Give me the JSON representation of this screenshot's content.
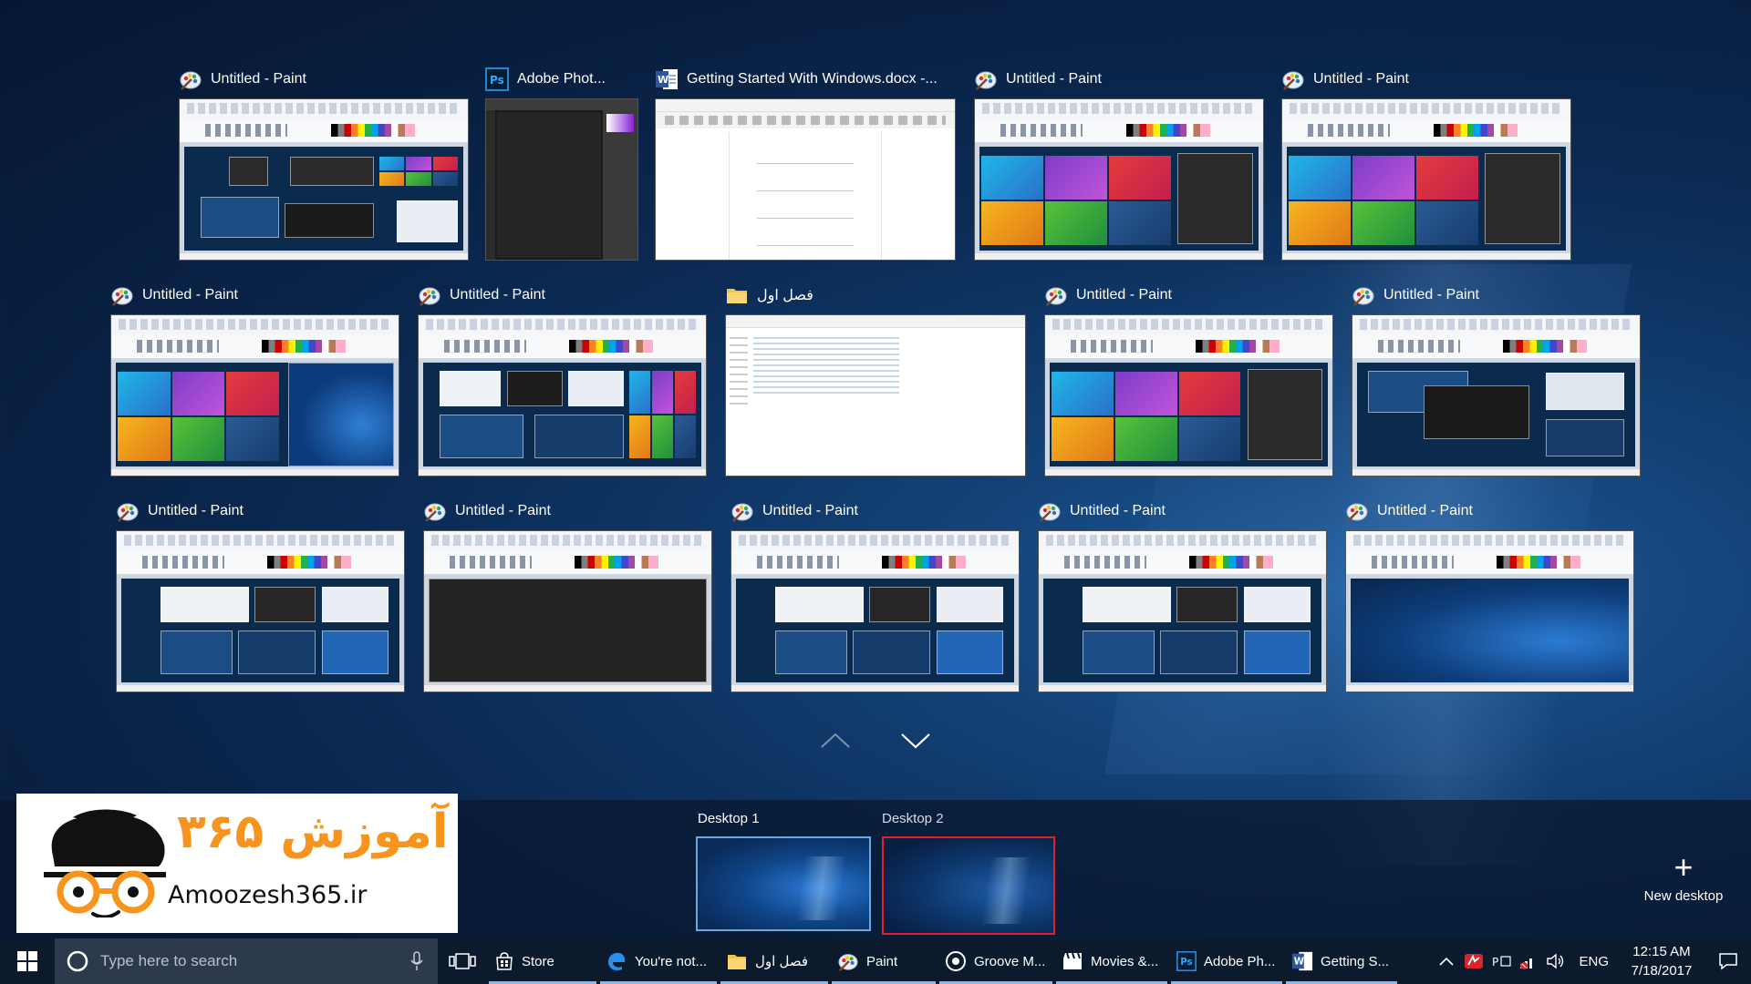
{
  "task_view": {
    "windows": [
      {
        "id": "w1",
        "app": "paint",
        "title": "Untitled - Paint"
      },
      {
        "id": "w2",
        "app": "photoshop",
        "title": "Adobe Phot..."
      },
      {
        "id": "w3",
        "app": "word",
        "title": "Getting Started With Windows.docx -..."
      },
      {
        "id": "w4",
        "app": "paint",
        "title": "Untitled - Paint"
      },
      {
        "id": "w5",
        "app": "paint",
        "title": "Untitled - Paint"
      },
      {
        "id": "w6",
        "app": "paint",
        "title": "Untitled - Paint"
      },
      {
        "id": "w7",
        "app": "paint",
        "title": "Untitled - Paint"
      },
      {
        "id": "w8",
        "app": "explorer",
        "title": "فصل اول"
      },
      {
        "id": "w9",
        "app": "paint",
        "title": "Untitled - Paint"
      },
      {
        "id": "w10",
        "app": "paint",
        "title": "Untitled - Paint"
      },
      {
        "id": "w11",
        "app": "paint",
        "title": "Untitled - Paint"
      },
      {
        "id": "w12",
        "app": "paint",
        "title": "Untitled - Paint"
      },
      {
        "id": "w13",
        "app": "paint",
        "title": "Untitled - Paint"
      },
      {
        "id": "w14",
        "app": "paint",
        "title": "Untitled - Paint"
      },
      {
        "id": "w15",
        "app": "paint",
        "title": "Untitled - Paint"
      }
    ],
    "scroll": {
      "up_icon": "chevron-up-icon",
      "down_icon": "chevron-down-icon"
    }
  },
  "desktops": {
    "items": [
      {
        "label": "Desktop 1",
        "active": true
      },
      {
        "label": "Desktop 2",
        "active": false
      }
    ],
    "new_desktop_label": "New desktop"
  },
  "logo": {
    "persian_text": "آموزش ۳۶۵",
    "site_text": "Amoozesh365.ir"
  },
  "taskbar": {
    "search_placeholder": "Type here to search",
    "apps": [
      {
        "icon": "store-icon",
        "label": "Store"
      },
      {
        "icon": "edge-icon",
        "label": "You're not..."
      },
      {
        "icon": "folder-icon",
        "label": "فصل اول"
      },
      {
        "icon": "paint-icon",
        "label": "Paint"
      },
      {
        "icon": "groove-icon",
        "label": "Groove M..."
      },
      {
        "icon": "movies-icon",
        "label": "Movies &..."
      },
      {
        "icon": "photoshop-icon",
        "label": "Adobe Ph..."
      },
      {
        "icon": "word-icon",
        "label": "Getting S..."
      }
    ],
    "language": "ENG",
    "time": "12:15 AM",
    "date": "7/18/2017"
  },
  "colors": {
    "desktop_active_border": "#6aa8e0",
    "desktop_selected_border": "#e3202a",
    "taskbar_bg": "#0c1a2e",
    "logo_orange": "#f7941d"
  }
}
